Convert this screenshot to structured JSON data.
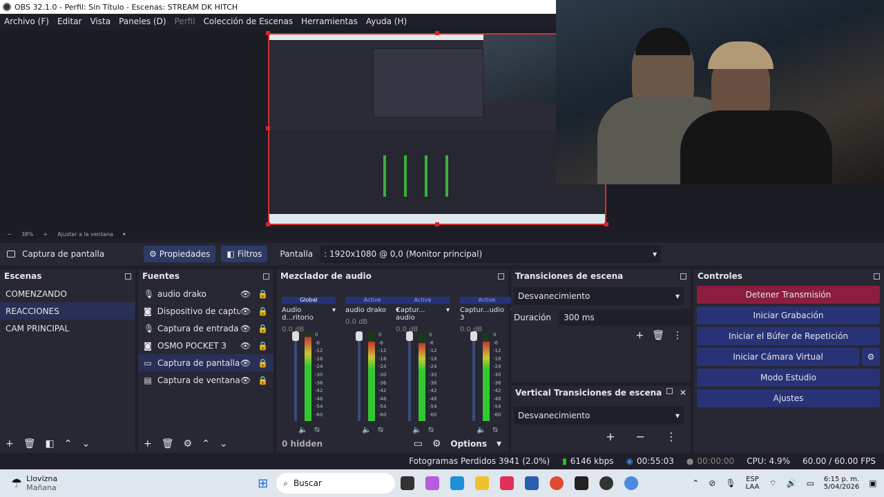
{
  "window": {
    "title": "OBS 32.1.0 - Perfil: Sin Título - Escenas: STREAM DK HITCH"
  },
  "menu": [
    "Archivo (F)",
    "Editar",
    "Vista",
    "Paneles (D)",
    "Perfil",
    "Colección de Escenas",
    "Herramientas",
    "Ayuda (H)"
  ],
  "zoom": {
    "minus": "−",
    "level": "38%",
    "plus": "+",
    "fit": "Ajustar a la ventana"
  },
  "source_bar": {
    "source_name": "Captura de pantalla",
    "properties": "Propiedades",
    "filters": "Filtros",
    "display_label": "Pantalla",
    "display_value": ": 1920x1080 @ 0,0 (Monitor principal)"
  },
  "scenes": {
    "title": "Escenas",
    "items": [
      "COMENZANDO",
      "REACCIONES",
      "CAM PRINCIPAL"
    ],
    "selected": 1
  },
  "sources": {
    "title": "Fuentes",
    "items": [
      {
        "label": "audio drako",
        "icon": "microphone-icon"
      },
      {
        "label": "Dispositivo de captura d",
        "icon": "camera-icon"
      },
      {
        "label": "Captura de entrada aud",
        "icon": "microphone-icon"
      },
      {
        "label": "OSMO POCKET 3",
        "icon": "camera-icon"
      },
      {
        "label": "Captura de pantalla",
        "icon": "monitor-icon"
      },
      {
        "label": "Captura de ventana",
        "icon": "window-icon"
      }
    ],
    "selected": 4
  },
  "mixer": {
    "title": "Mezclador de audio",
    "channels": [
      {
        "tag": "Global",
        "name": "Audio d...ritorio",
        "db": "0.0 dB",
        "level": 0.95
      },
      {
        "tag": "Active",
        "name": "audio drako",
        "db": "0.0 dB",
        "level": 0.9
      },
      {
        "tag": "Active",
        "name": "Captur... audio",
        "db": "0.0 dB",
        "level": 0.88
      },
      {
        "tag": "Active",
        "name": "Captur...udio 3",
        "db": "0.0 dB",
        "level": 0.9
      }
    ],
    "scale": [
      "0",
      "-6",
      "-12",
      "-18",
      "-24",
      "-30",
      "-36",
      "-42",
      "-48",
      "-54",
      "-60"
    ],
    "hidden": "0 hidden",
    "options": "Options"
  },
  "transitions": {
    "title": "Transiciones de escena",
    "type": "Desvanecimiento",
    "duration_label": "Duración",
    "duration_value": "300 ms"
  },
  "vertical_transitions": {
    "title": "Vertical Transiciones de escena",
    "type": "Desvanecimiento"
  },
  "controls": {
    "title": "Controles",
    "buttons": [
      "Detener Transmisión",
      "Iniciar Grabación",
      "Iniciar el Búfer de Repetición",
      "Iniciar Cámara Virtual",
      "Modo Estudio",
      "Ajustes"
    ]
  },
  "status": {
    "dropped": "Fotogramas Perdidos 3941 (2.0%)",
    "bitrate": "6146 kbps",
    "stream_time": "00:55:03",
    "rec_time": "00:00:00",
    "cpu": "CPU: 4.9%",
    "fps": "60.00 / 60.00 FPS"
  },
  "taskbar": {
    "weather_title": "Llovizna",
    "weather_sub": "Mañana",
    "search": "Buscar",
    "lang1": "ESP",
    "lang2": "LAA",
    "time": "6:15 p. m.",
    "date": "5/04/2026"
  },
  "colors": {
    "accent": "#283377",
    "stop": "#8b1e3f",
    "meter_green": "#32c832"
  }
}
